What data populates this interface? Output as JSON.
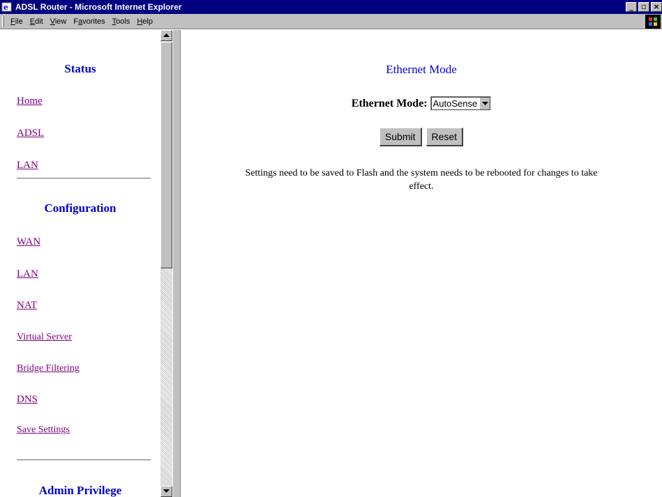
{
  "window": {
    "title": "ADSL Router - Microsoft Internet Explorer",
    "icon": "ie-page-icon",
    "controls": [
      "minimize",
      "maximize",
      "close"
    ]
  },
  "menubar": {
    "items": [
      {
        "label": "File",
        "accel": "F"
      },
      {
        "label": "Edit",
        "accel": "E"
      },
      {
        "label": "View",
        "accel": "V"
      },
      {
        "label": "Favorites",
        "accel": "a"
      },
      {
        "label": "Tools",
        "accel": "T"
      },
      {
        "label": "Help",
        "accel": "H"
      }
    ],
    "logo": "windows-flag-icon"
  },
  "sidebar": {
    "status_heading": "Status",
    "status_links": [
      "Home",
      "ADSL",
      "LAN"
    ],
    "config_heading": "Configuration",
    "config_links": [
      "WAN",
      "LAN",
      "NAT",
      "Virtual Server",
      "Bridge Filtering",
      "DNS",
      "Save Settings"
    ],
    "admin_heading": "Admin Privilege"
  },
  "main": {
    "title": "Ethernet Mode",
    "field_label": "Ethernet Mode:",
    "select_value": "AutoSense",
    "submit_label": "Submit",
    "reset_label": "Reset",
    "note_line1": "Settings need to be saved to Flash and the system needs to be rebooted for changes to take",
    "note_line2": "effect."
  },
  "colors": {
    "titlebar": "#000080",
    "heading": "#0000cc",
    "visited_link": "#800080",
    "chrome": "#c0c0c0"
  }
}
